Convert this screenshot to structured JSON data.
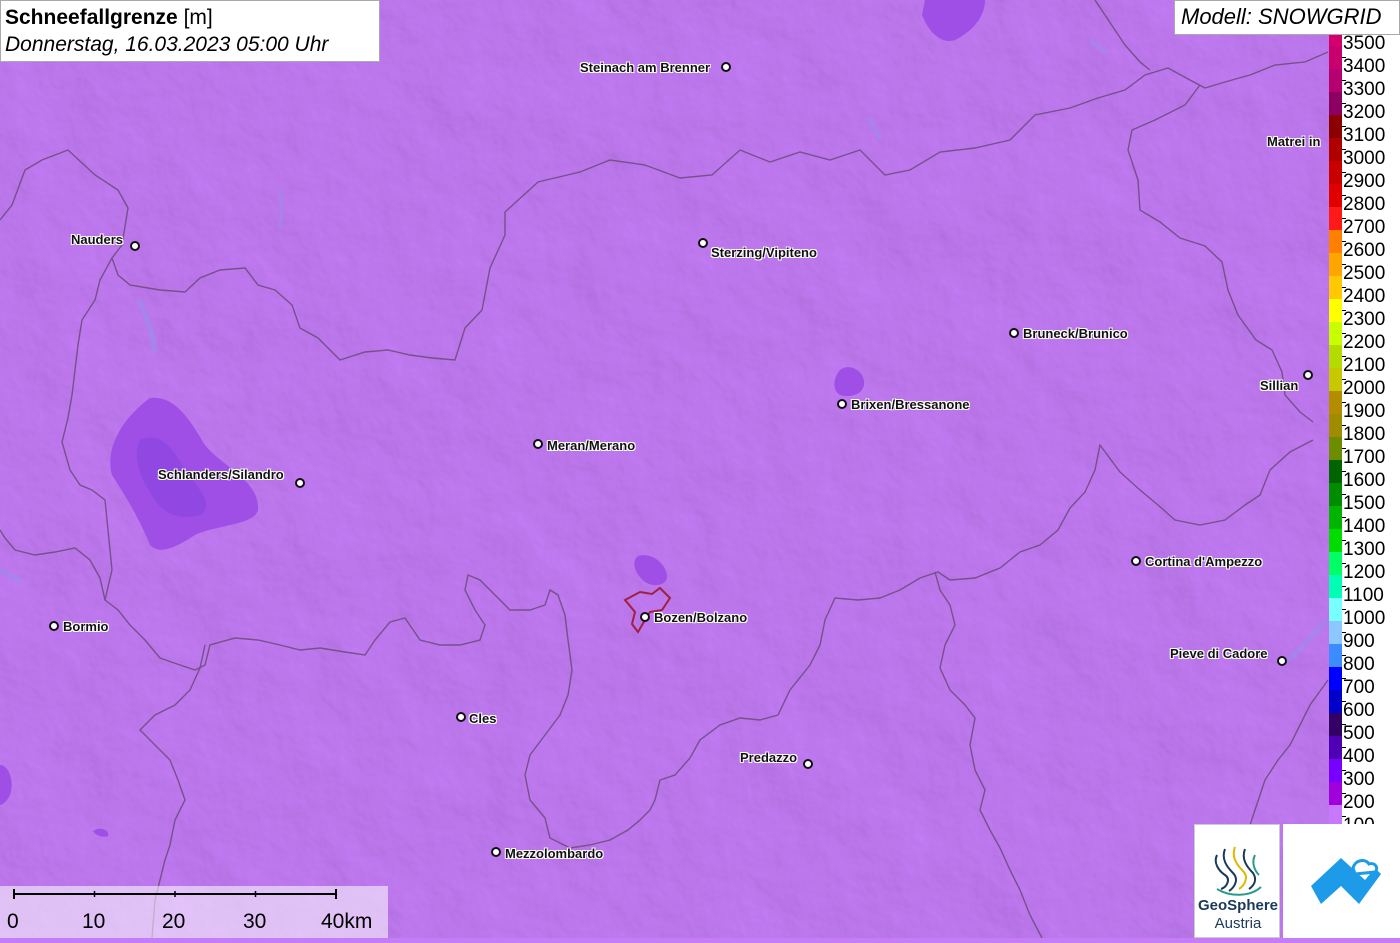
{
  "header": {
    "title": "Schneefallgrenze",
    "unit": "[m]",
    "datetime": "Donnerstag, 16.03.2023 05:00 Uhr"
  },
  "model": {
    "label": "Modell: SNOWGRID"
  },
  "legend": {
    "items": [
      {
        "label": "3500",
        "color": "#d4006e"
      },
      {
        "label": "3400",
        "color": "#c8006e"
      },
      {
        "label": "3300",
        "color": "#b40070"
      },
      {
        "label": "3200",
        "color": "#8c0064"
      },
      {
        "label": "3100",
        "color": "#8b0000"
      },
      {
        "label": "3000",
        "color": "#b00000"
      },
      {
        "label": "2900",
        "color": "#c80000"
      },
      {
        "label": "2800",
        "color": "#e00000"
      },
      {
        "label": "2700",
        "color": "#ff1a1a"
      },
      {
        "label": "2600",
        "color": "#ff7f00"
      },
      {
        "label": "2500",
        "color": "#ffa500"
      },
      {
        "label": "2400",
        "color": "#ffc800"
      },
      {
        "label": "2300",
        "color": "#ffff00"
      },
      {
        "label": "2200",
        "color": "#c8ff00"
      },
      {
        "label": "2100",
        "color": "#b4dc00"
      },
      {
        "label": "2000",
        "color": "#c8c800"
      },
      {
        "label": "1900",
        "color": "#b48c00"
      },
      {
        "label": "1800",
        "color": "#a08c00"
      },
      {
        "label": "1700",
        "color": "#6e8c00"
      },
      {
        "label": "1600",
        "color": "#006400"
      },
      {
        "label": "1500",
        "color": "#008c00"
      },
      {
        "label": "1400",
        "color": "#00b400"
      },
      {
        "label": "1300",
        "color": "#00dc00"
      },
      {
        "label": "1200",
        "color": "#00ff64"
      },
      {
        "label": "1100",
        "color": "#00ffb4"
      },
      {
        "label": "1000",
        "color": "#78ffff"
      },
      {
        "label": "900",
        "color": "#8cc8ff"
      },
      {
        "label": "800",
        "color": "#3c8cff"
      },
      {
        "label": "700",
        "color": "#0000ff"
      },
      {
        "label": "600",
        "color": "#0000c8"
      },
      {
        "label": "500",
        "color": "#320064"
      },
      {
        "label": "400",
        "color": "#5000b4"
      },
      {
        "label": "300",
        "color": "#7800ff"
      },
      {
        "label": "200",
        "color": "#a000dc"
      },
      {
        "label": "100",
        "color": "#c878ff"
      }
    ]
  },
  "cities": [
    {
      "name": "Steinach am Brenner",
      "key": "steinach"
    },
    {
      "name": "Matrei in",
      "key": "matrei"
    },
    {
      "name": "Nauders",
      "key": "nauders"
    },
    {
      "name": "Sterzing/Vipiteno",
      "key": "sterzing"
    },
    {
      "name": "Bruneck/Brunico",
      "key": "bruneck"
    },
    {
      "name": "Sillian",
      "key": "sillian"
    },
    {
      "name": "Brixen/Bressanone",
      "key": "brixen"
    },
    {
      "name": "Meran/Merano",
      "key": "meran"
    },
    {
      "name": "Schlanders/Silandro",
      "key": "schlanders"
    },
    {
      "name": "Cortina d'Ampezzo",
      "key": "cortina"
    },
    {
      "name": "Bormio",
      "key": "bormio"
    },
    {
      "name": "Bozen/Bolzano",
      "key": "bozen"
    },
    {
      "name": "Pieve di Cadore",
      "key": "pieve"
    },
    {
      "name": "Cles",
      "key": "cles"
    },
    {
      "name": "Predazzo",
      "key": "predazzo"
    },
    {
      "name": "Mezzolombardo",
      "key": "mezzolombardo"
    }
  ],
  "scalebar": {
    "labels": [
      "0",
      "10",
      "20",
      "30",
      "40km"
    ]
  },
  "logos": {
    "geosphere_line1": "GeoSphere",
    "geosphere_line2": "Austria"
  },
  "colors": {
    "background": "#c57df7",
    "low_area": "#a04fe6",
    "border_line": "#6a4a7a"
  }
}
